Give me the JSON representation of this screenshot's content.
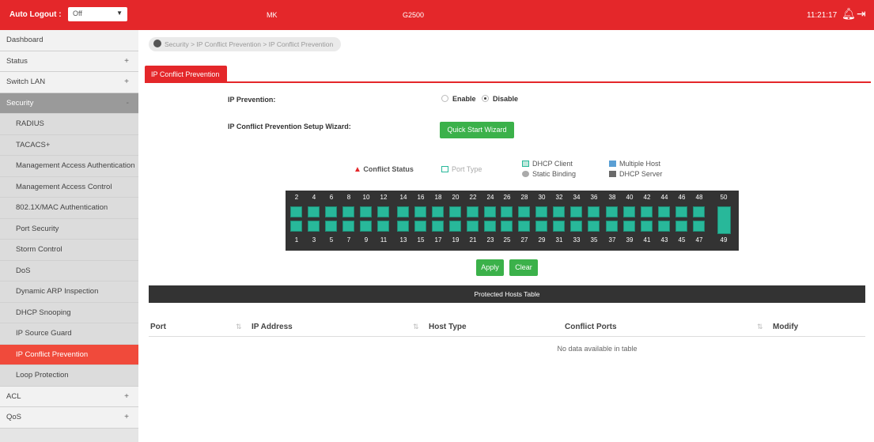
{
  "topbar": {
    "auto_logout_label": "Auto Logout :",
    "auto_logout_value": "Off",
    "model": "MK",
    "device": "G2500",
    "time": "11:21:17",
    "accent": "#e4272a"
  },
  "sidebar": {
    "items": [
      {
        "label": "Dashboard",
        "pm": ""
      },
      {
        "label": "Status",
        "pm": "+"
      },
      {
        "label": "Switch LAN",
        "pm": "+"
      },
      {
        "label": "Security",
        "pm": "-"
      },
      {
        "label": "RADIUS",
        "pm": ""
      },
      {
        "label": "TACACS+",
        "pm": ""
      },
      {
        "label": "Management Access Authentication",
        "pm": ""
      },
      {
        "label": "Management Access Control",
        "pm": ""
      },
      {
        "label": "802.1X/MAC Authentication",
        "pm": ""
      },
      {
        "label": "Port Security",
        "pm": ""
      },
      {
        "label": "Storm Control",
        "pm": ""
      },
      {
        "label": "DoS",
        "pm": ""
      },
      {
        "label": "Dynamic ARP Inspection",
        "pm": ""
      },
      {
        "label": "DHCP Snooping",
        "pm": ""
      },
      {
        "label": "IP Source Guard",
        "pm": ""
      },
      {
        "label": "IP Conflict Prevention",
        "pm": ""
      },
      {
        "label": "Loop Protection",
        "pm": ""
      },
      {
        "label": "ACL",
        "pm": "+"
      },
      {
        "label": "QoS",
        "pm": "+"
      }
    ]
  },
  "breadcrumb": "Security > IP Conflict Prevention > IP Conflict Prevention",
  "tab_label": "IP Conflict Prevention",
  "form": {
    "ip_prevention_label": "IP Prevention:",
    "enable_label": "Enable",
    "disable_label": "Disable",
    "selected": "Disable",
    "wizard_label": "IP Conflict Prevention Setup Wizard:",
    "wizard_button": "Quick Start Wizard"
  },
  "legend": {
    "conflict_status": "Conflict Status",
    "port_type": "Port Type",
    "dhcp_client": "DHCP Client",
    "static_binding": "Static Binding",
    "multiple_host": "Multiple Host",
    "dhcp_server": "DHCP Server"
  },
  "ports": {
    "top": [
      "2",
      "4",
      "6",
      "8",
      "10",
      "12",
      "14",
      "16",
      "18",
      "20",
      "22",
      "24",
      "26",
      "28",
      "30",
      "32",
      "34",
      "36",
      "38",
      "40",
      "42",
      "44",
      "46",
      "48",
      "50"
    ],
    "bottom": [
      "1",
      "3",
      "5",
      "7",
      "9",
      "11",
      "13",
      "15",
      "17",
      "19",
      "21",
      "23",
      "25",
      "27",
      "29",
      "31",
      "33",
      "35",
      "37",
      "39",
      "41",
      "43",
      "45",
      "47",
      "49"
    ]
  },
  "buttons": {
    "apply": "Apply",
    "clear": "Clear"
  },
  "table": {
    "title": "Protected Hosts Table",
    "columns": [
      "Port",
      "IP Address",
      "Host Type",
      "Conflict Ports",
      "Modify"
    ],
    "empty_text": "No data available in table"
  }
}
